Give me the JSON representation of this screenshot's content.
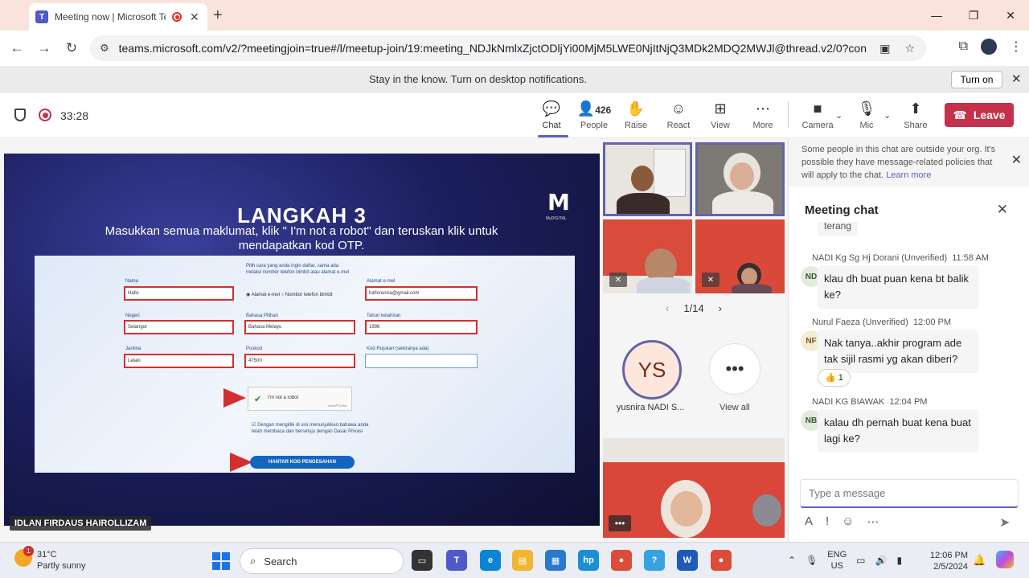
{
  "browser": {
    "tab_title": "Meeting now | Microsoft Teams",
    "tab_favicon": "T",
    "new_tab": "+",
    "url": "teams.microsoft.com/v2/?meetingjoin=true#/l/meetup-join/19:meeting_NDJkNmlxZjctODljYi00MjM5LWE0NjItNjQ3MDk2MDQ2MWJl@thread.v2/0?context=%7..."
  },
  "notification": {
    "text": "Stay in the know. Turn on desktop notifications.",
    "button": "Turn on"
  },
  "toolbar": {
    "timer": "33:28",
    "chat": "Chat",
    "people": "People",
    "people_count": "426",
    "raise": "Raise",
    "react": "React",
    "view": "View",
    "more": "More",
    "camera": "Camera",
    "mic": "Mic",
    "share": "Share",
    "leave": "Leave"
  },
  "slide": {
    "title": "LANGKAH 3",
    "subtitle": "Masukkan semua maklumat, klik \" I'm not a robot\" dan teruskan klik untuk mendapatkan kod OTP.",
    "logo_sub": "MyDIGITAL",
    "note": "Pilih cara yang anda ingin daftar, sama ada melalui nombor telefon bimbit atau alamat e-mel",
    "radio_email": "Alamat e-mel",
    "radio_phone": "Nombor telefon bimbit",
    "labels": {
      "nama": "Nama",
      "email": "Alamat e-mel",
      "negeri": "Negeri",
      "bahasa": "Bahasa Pilihan",
      "tahun": "Tahun kelahiran",
      "jantina": "Jantina",
      "poskod": "Poskod",
      "rujukan": "Kod Rujukan (sekiranya ada)"
    },
    "values": {
      "nama": "Hafis",
      "email": "hafisnurisa@gmail.com",
      "negeri": "Selangor",
      "bahasa": "Bahasa Melayu",
      "tahun": "1998",
      "jantina": "Lelaki",
      "poskod": "47500",
      "rujukan": ""
    },
    "captcha": "I'm not a robot",
    "captcha_brand": "reCAPTCHA",
    "consent": "Dengan mengklik di sini menunjukkan bahawa anda telah membaca dan bersetuju dengan Dasar Privasi",
    "submit": "HANTAR KOD PENGESAHAN"
  },
  "presenter_name": "IDLAN FIRDAUS HAIROLLIZAM",
  "gallery": {
    "pager": "1/14",
    "avatar_initials": "YS",
    "avatar_name": "yusnira NADI S...",
    "view_all": "View all"
  },
  "chat": {
    "policy_text": "Some people in this chat are outside your org. It's possible they have message-related policies that will apply to the chat.",
    "policy_link": "Learn more",
    "title": "Meeting chat",
    "messages": [
      {
        "sender": "NADI Kg Sg Hj Dorani (Unverified)",
        "time": "11:58 AM",
        "initials": "ND",
        "text": "klau dh buat puan kena bt balik ke?"
      },
      {
        "sender": "Nurul Faeza (Unverified)",
        "time": "12:00 PM",
        "initials": "NF",
        "text": "Nak tanya..akhir program ade tak sijil rasmi yg akan diberi?",
        "reaction": "👍 1"
      },
      {
        "sender": "NADI KG BIAWAK",
        "time": "12:04 PM",
        "initials": "NB",
        "text": "kalau dh pernah buat kena buat lagi ke?"
      }
    ],
    "partial_text": "terang",
    "compose_placeholder": "Type a message"
  },
  "taskbar": {
    "temp": "31°C",
    "weather": "Partly sunny",
    "weather_badge": "1",
    "search": "Search",
    "lang1": "ENG",
    "lang2": "US",
    "time": "12:06 PM",
    "date": "2/5/2024"
  },
  "colors": {
    "accent": "#5b5fc7",
    "leave": "#c4314b",
    "tabstrip": "#fbe3dd"
  }
}
